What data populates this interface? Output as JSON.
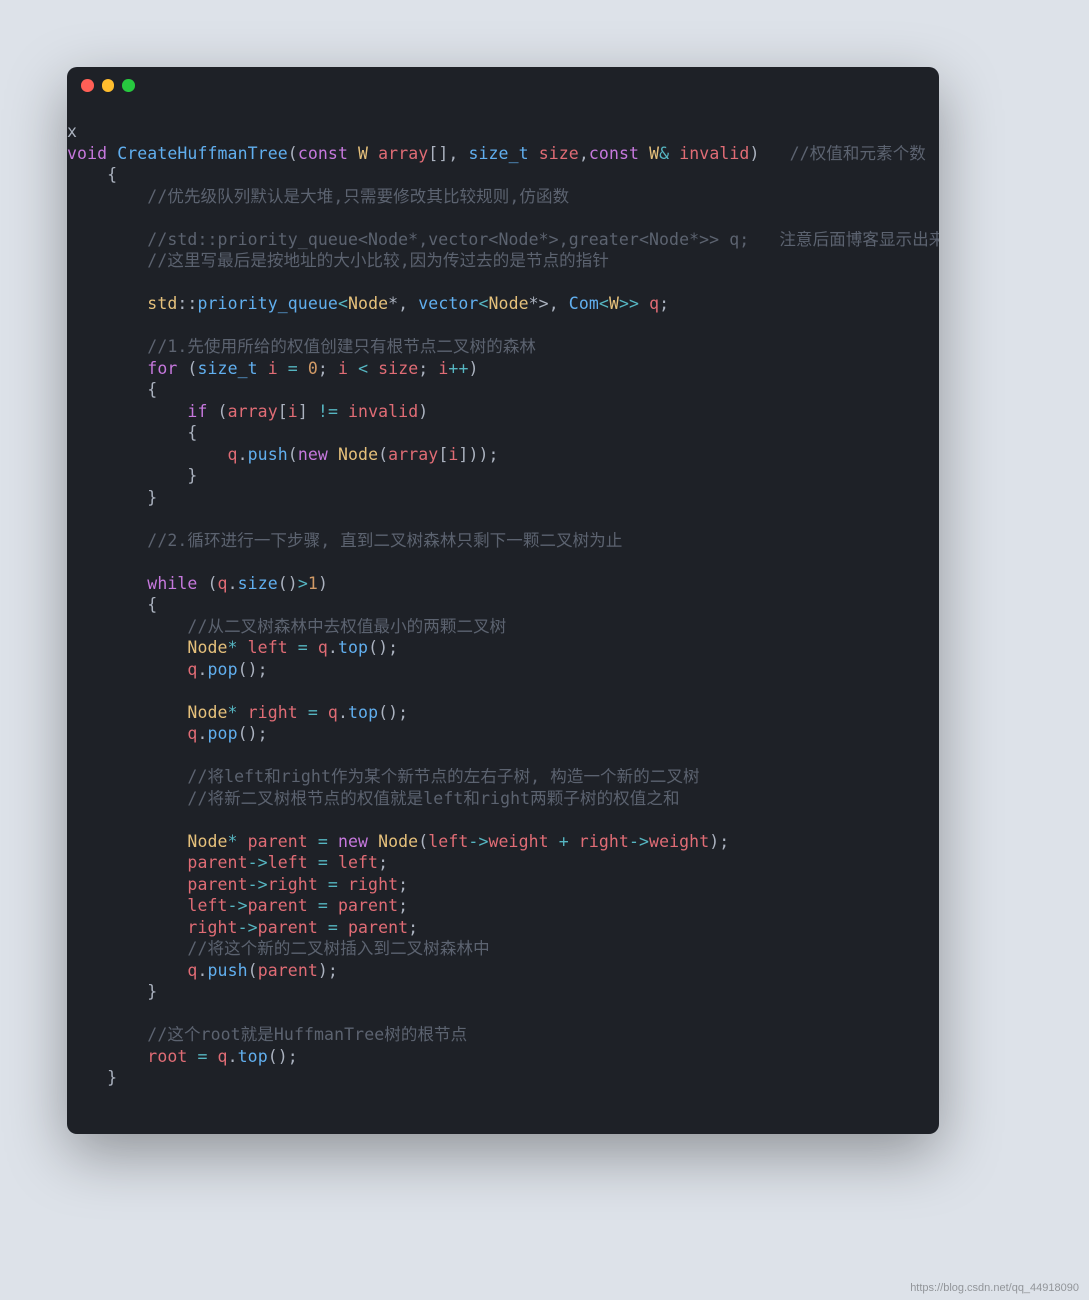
{
  "window": {
    "traffic_lights": [
      "red",
      "yellow",
      "green"
    ]
  },
  "code": {
    "l01": "x",
    "l02": {
      "kw1": "void",
      "fn": "CreateHuffmanTree",
      "pun1": "(",
      "kw2": "const",
      "type": "W",
      "var": "array",
      "pun2": "[], ",
      "typeB": "size_t",
      "var2": "size",
      "pun3": ",",
      "kw3": "const",
      "type2": "W",
      "op": "&",
      "var3": "invalid",
      "pun4": ")",
      "cmt": "   //权值和元素个数"
    },
    "l03": {
      "pun": "{"
    },
    "l04": {
      "cmt": "//优先级队列默认是大堆,只需要修改其比较规则,仿函数"
    },
    "l05": {
      "cmt": "//std::priority_queue<Node*,vector<Node*>,greater<Node*>> q;   注意后面博客显示出来"
    },
    "l06": {
      "cmt": "//这里写最后是按地址的大小比较,因为传过去的是节点的指针"
    },
    "l07": {
      "std": "std",
      "op1": "::",
      "t": "priority_queue",
      "lt1": "<",
      "n1": "Node",
      "op2": "*, ",
      "t2": "vector",
      "lt2": "<",
      "n2": "Node",
      "op3": "*>, ",
      "t3": "Com",
      "lt3": "<",
      "n3": "W",
      "gt": ">>",
      "var": " q",
      "pun": ";"
    },
    "l08": {
      "cmt": "//1.先使用所给的权值创建只有根节点二叉树的森林"
    },
    "l09": {
      "kw": "for",
      "p1": " (",
      "t": "size_t",
      "v": " i",
      "op1": " = ",
      "num": "0",
      "p2": "; ",
      "v2": "i",
      "op2": " < ",
      "v3": "size",
      "p3": "; ",
      "v4": "i",
      "op3": "++",
      "p4": ")"
    },
    "l10": {
      "pun": "{"
    },
    "l11": {
      "kw": "if",
      "p1": " (",
      "v": "array",
      "p2": "[",
      "v2": "i",
      "p3": "] ",
      "op": "!= ",
      "v3": "invalid",
      "p4": ")"
    },
    "l12": {
      "pun": "{"
    },
    "l13": {
      "v": "q",
      "p1": ".",
      "fn": "push",
      "p2": "(",
      "kw": "new",
      "t": " Node",
      "p3": "(",
      "v2": "array",
      "p4": "[",
      "v3": "i",
      "p5": "]));"
    },
    "l14": {
      "pun": "}"
    },
    "l15": {
      "pun": "}"
    },
    "l16": {
      "cmt": "//2.循环进行一下步骤, 直到二叉树森林只剩下一颗二叉树为止"
    },
    "l17": {
      "kw": "while",
      "p1": " (",
      "v": "q",
      "p2": ".",
      "fn": "size",
      "p3": "()",
      "op": ">",
      "num": "1",
      "p4": ")"
    },
    "l18": {
      "pun": "{"
    },
    "l19": {
      "cmt": "//从二叉树森林中去权值最小的两颗二叉树"
    },
    "l20": {
      "t": "Node",
      "op": "* ",
      "v": "left",
      "op2": " = ",
      "v2": "q",
      "p": ".",
      "fn": "top",
      "p2": "();"
    },
    "l21": {
      "v": "q",
      "p": ".",
      "fn": "pop",
      "p2": "();"
    },
    "l22": {
      "t": "Node",
      "op": "* ",
      "v": "right",
      "op2": " = ",
      "v2": "q",
      "p": ".",
      "fn": "top",
      "p2": "();"
    },
    "l23": {
      "v": "q",
      "p": ".",
      "fn": "pop",
      "p2": "();"
    },
    "l24": {
      "cmt": "//将left和right作为某个新节点的左右子树, 构造一个新的二叉树"
    },
    "l25": {
      "cmt": "//将新二叉树根节点的权值就是left和right两颗子树的权值之和"
    },
    "l26": {
      "t": "Node",
      "op": "* ",
      "v": "parent",
      "op2": " = ",
      "kw": "new",
      "t2": " Node",
      "p1": "(",
      "v2": "left",
      "op3": "->",
      "v3": "weight",
      "op4": " + ",
      "v4": "right",
      "op5": "->",
      "v5": "weight",
      "p2": ");"
    },
    "l27": {
      "v": "parent",
      "op": "->",
      "v2": "left",
      "op2": " = ",
      "v3": "left",
      "p": ";"
    },
    "l28": {
      "v": "parent",
      "op": "->",
      "v2": "right",
      "op2": " = ",
      "v3": "right",
      "p": ";"
    },
    "l29": {
      "v": "left",
      "op": "->",
      "v2": "parent",
      "op2": " = ",
      "v3": "parent",
      "p": ";"
    },
    "l30": {
      "v": "right",
      "op": "->",
      "v2": "parent",
      "op2": " = ",
      "v3": "parent",
      "p": ";"
    },
    "l31": {
      "cmt": "//将这个新的二叉树插入到二叉树森林中"
    },
    "l32": {
      "v": "q",
      "p": ".",
      "fn": "push",
      "p2": "(",
      "v2": "parent",
      "p3": ");"
    },
    "l33": {
      "pun": "}"
    },
    "l34": {
      "cmt": "//这个root就是HuffmanTree树的根节点"
    },
    "l35": {
      "v": "root",
      "op": " = ",
      "v2": "q",
      "p": ".",
      "fn": "top",
      "p2": "();"
    },
    "l36": {
      "pun": "}"
    }
  },
  "watermark": "https://blog.csdn.net/qq_44918090"
}
